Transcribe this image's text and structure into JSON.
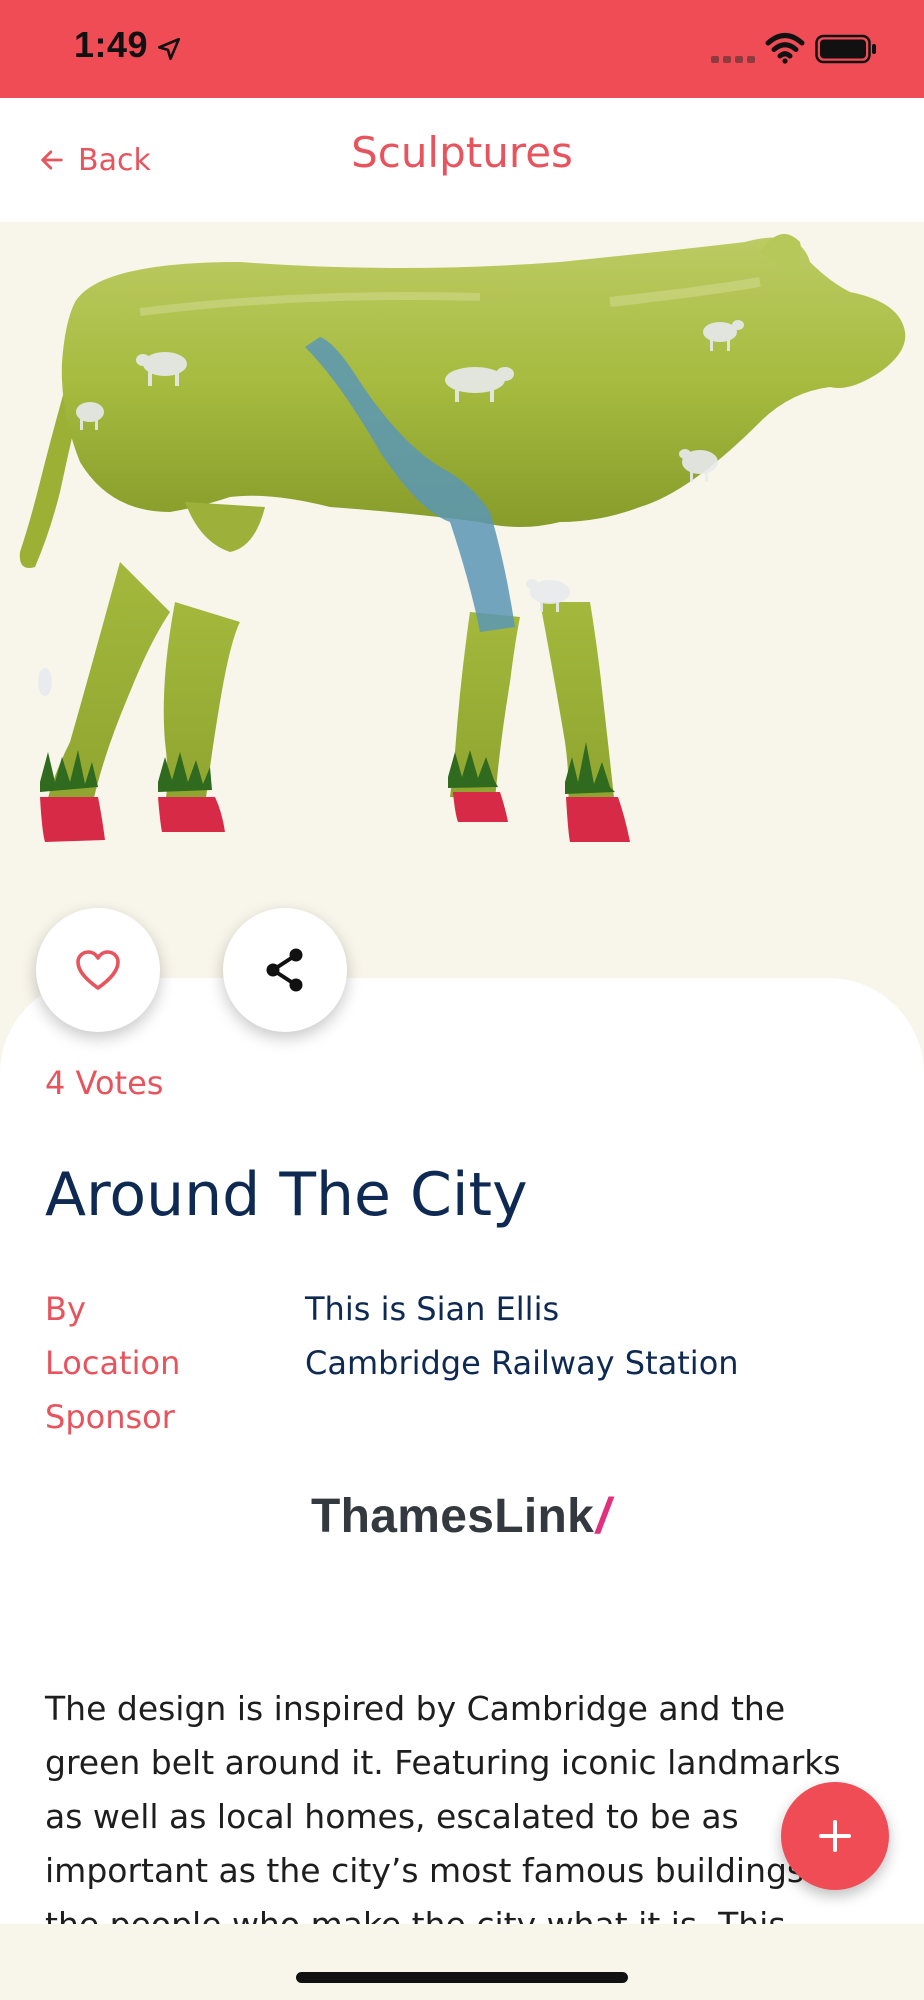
{
  "status_bar": {
    "time": "1:49",
    "icons": [
      "location-arrow-icon",
      "signal-icon",
      "wifi-icon",
      "battery-icon"
    ],
    "background": "#f04c56"
  },
  "nav": {
    "back_label": "Back",
    "back_icon": "arrow-left-icon",
    "title": "Sculptures"
  },
  "hero": {
    "image": "green painted cow sculpture with sheep silhouettes",
    "background": "#f8f5ea"
  },
  "actions": {
    "like_icon": "heart-icon",
    "share_icon": "share-icon"
  },
  "votes": "4 Votes",
  "sculpture": {
    "title": "Around The City",
    "details": [
      {
        "label": "By",
        "value": "This is Sian Ellis"
      },
      {
        "label": "Location",
        "value": "Cambridge Railway Station"
      },
      {
        "label": "Sponsor",
        "value": ""
      }
    ],
    "sponsor_logo_text": "ThamesLink",
    "sponsor_logo_mark": "/",
    "description": "The design is inspired by Cambridge and the green belt around it. Featuring iconic landmarks as well as local homes, escalated to be as important as the city’s most famous buildings is the people who make the city what it is. This"
  },
  "fab": {
    "icon": "plus-icon"
  },
  "colors": {
    "accent": "#e8545d",
    "navy": "#0e2952",
    "cow_green": "#a5bb3d",
    "hoof_red": "#d62a46"
  }
}
